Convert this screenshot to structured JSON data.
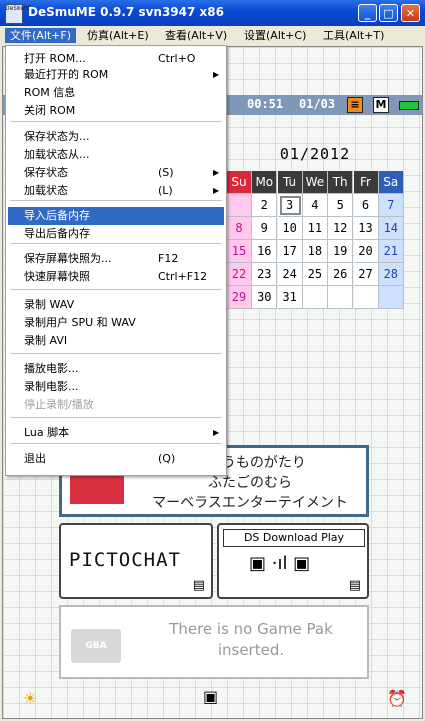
{
  "window": {
    "title": "DeSmuME 0.9.7 svn3947 x86",
    "app_icon_text": "DeSmuME"
  },
  "menubar": [
    {
      "label": "文件(Alt+F)"
    },
    {
      "label": "仿真(Alt+E)"
    },
    {
      "label": "查看(Alt+V)"
    },
    {
      "label": "设置(Alt+C)"
    },
    {
      "label": "工具(Alt+T)"
    }
  ],
  "file_menu": {
    "items": [
      {
        "label": "打开 ROM...",
        "shortcut": "Ctrl+O"
      },
      {
        "label": "最近打开的 ROM",
        "submenu": true
      },
      {
        "label": "ROM 信息"
      },
      {
        "label": "关闭 ROM"
      },
      {
        "label": "保存状态为..."
      },
      {
        "label": "加载状态从..."
      },
      {
        "label": "保存状态",
        "shortcut": "(S)",
        "submenu": true
      },
      {
        "label": "加载状态",
        "shortcut": "(L)",
        "submenu": true
      },
      {
        "label": "导入后备内存",
        "highlighted": true
      },
      {
        "label": "导出后备内存"
      },
      {
        "label": "保存屏幕快照为...",
        "shortcut": "F12"
      },
      {
        "label": "快速屏幕快照",
        "shortcut": "Ctrl+F12"
      },
      {
        "label": "录制 WAV"
      },
      {
        "label": "录制用户 SPU 和 WAV"
      },
      {
        "label": "录制 AVI"
      },
      {
        "label": "播放电影..."
      },
      {
        "label": "录制电影..."
      },
      {
        "label": "停止录制/播放",
        "disabled": true
      },
      {
        "label": "Lua 脚本",
        "submenu": true
      },
      {
        "label": "退出",
        "shortcut": "(Q)"
      }
    ],
    "submenu_arrow": "▶"
  },
  "ds_top": {
    "clock": "00:51",
    "date": "01/03",
    "mode_icon_text": "M"
  },
  "calendar": {
    "month": "01/2012",
    "weekdays": [
      "Su",
      "Mo",
      "Tu",
      "We",
      "Th",
      "Fr",
      "Sa"
    ],
    "weeks": [
      [
        "",
        "2",
        "3",
        "4",
        "5",
        "6",
        "7"
      ],
      [
        "8",
        "9",
        "10",
        "11",
        "12",
        "13",
        "14"
      ],
      [
        "15",
        "16",
        "17",
        "18",
        "19",
        "20",
        "21"
      ],
      [
        "22",
        "23",
        "24",
        "25",
        "26",
        "27",
        "28"
      ],
      [
        "29",
        "30",
        "31",
        "",
        "",
        "",
        ""
      ]
    ],
    "today": "3"
  },
  "game": {
    "lines": [
      "ぼくうものがたり",
      "ふたごのむら",
      "マーベラスエンターテイメント"
    ]
  },
  "pictochat": {
    "label": "PICTOCHAT"
  },
  "download_play": {
    "label": "DS Download Play"
  },
  "gba_slot": {
    "chip": "GBA",
    "message_line1": "There is no Game Pak",
    "message_line2": "inserted."
  }
}
